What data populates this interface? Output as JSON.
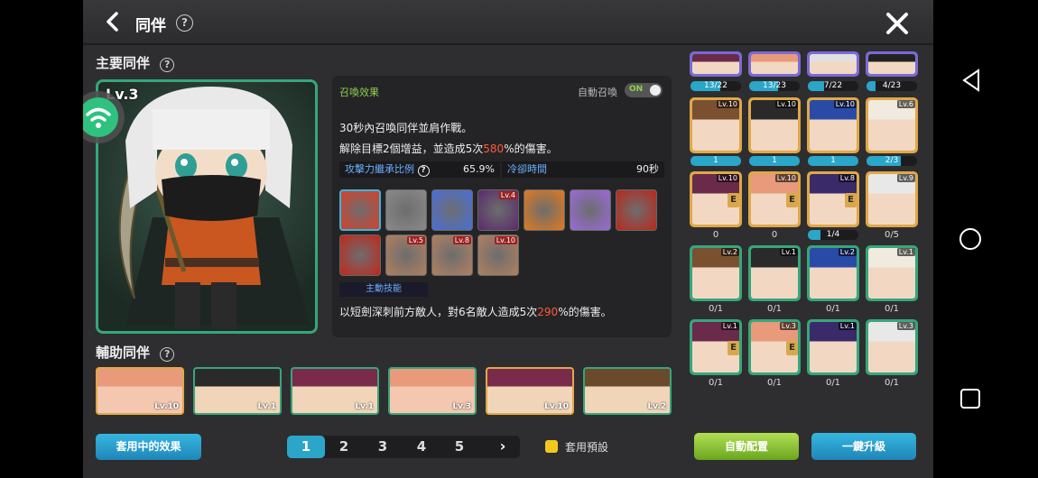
{
  "header": {
    "title": "同伴",
    "help": "?"
  },
  "main_section": {
    "title": "主要同伴",
    "help": "?"
  },
  "main_companion": {
    "level": "Lv.3"
  },
  "summon": {
    "label": "召喚效果",
    "auto_label": "自動召喚",
    "toggle": "ON",
    "line1": "30秒內召喚同伴並肩作戰。",
    "line2_pre": "解除目標2個增益，並造成5次",
    "line2_pct": "580",
    "line2_post": "%的傷害。",
    "stat1_label": "攻擊力繼承比例",
    "stat1_help": "?",
    "stat1_value": "65.9%",
    "stat2_label": "冷卻時間",
    "stat2_value": "90秒",
    "skill_label": "主動技能",
    "skill_desc_pre": "以短劍深刺前方敵人，對6名敵人造成5次",
    "skill_desc_pct": "290",
    "skill_desc_post": "%的傷害。",
    "skills": [
      {
        "lv": ""
      },
      {
        "lv": ""
      },
      {
        "lv": ""
      },
      {
        "lv": "Lv.4"
      },
      {
        "lv": ""
      },
      {
        "lv": ""
      },
      {
        "lv": ""
      },
      {
        "lv": ""
      },
      {
        "lv": "Lv.5"
      },
      {
        "lv": "Lv.8"
      },
      {
        "lv": "Lv.10"
      }
    ]
  },
  "sub_section": {
    "title": "輔助同伴",
    "help": "?"
  },
  "sub_companions": [
    {
      "lv": "Lv.10"
    },
    {
      "lv": "Lv.1"
    },
    {
      "lv": "Lv.1"
    },
    {
      "lv": "Lv.3"
    },
    {
      "lv": "Lv.10"
    },
    {
      "lv": "Lv.2"
    }
  ],
  "grid": {
    "row0": [
      {
        "progress": "13/22",
        "fraction": 0.59
      },
      {
        "progress": "13/23",
        "fraction": 0.57
      },
      {
        "progress": "7/22",
        "fraction": 0.32
      },
      {
        "progress": "4/23",
        "fraction": 0.17
      }
    ],
    "row1": [
      {
        "lv": "Lv.10",
        "progress": "1",
        "fraction": 1
      },
      {
        "lv": "Lv.10",
        "progress": "1",
        "fraction": 1
      },
      {
        "lv": "Lv.10",
        "progress": "1",
        "fraction": 1
      },
      {
        "lv": "Lv.6",
        "progress": "2/3",
        "fraction": 0.67
      }
    ],
    "row2": [
      {
        "lv": "Lv.10",
        "count": "0"
      },
      {
        "lv": "Lv.10",
        "count": "0"
      },
      {
        "lv": "Lv.8",
        "count": "1/4",
        "fraction": 0.25
      },
      {
        "lv": "Lv.9",
        "count": "0/5"
      }
    ],
    "row3": [
      {
        "lv": "Lv.2",
        "count": "0/1"
      },
      {
        "lv": "Lv.1",
        "count": "0/1"
      },
      {
        "lv": "Lv.2",
        "count": "0/1"
      },
      {
        "lv": "Lv.1",
        "count": "0/1"
      }
    ],
    "row4": [
      {
        "lv": "Lv.1",
        "count": "0/1"
      },
      {
        "lv": "Lv.3",
        "count": "0/1"
      },
      {
        "lv": "Lv.1",
        "count": "0/1"
      },
      {
        "lv": "Lv.3",
        "count": "0/1"
      }
    ]
  },
  "footer": {
    "apply_effect": "套用中的效果",
    "pages": [
      "1",
      "2",
      "3",
      "4",
      "5"
    ],
    "next": "›",
    "preset_label": "套用預設",
    "auto_config": "自動配置",
    "one_click_upgrade": "一鍵升級"
  },
  "colors": {
    "accent": "#2aa6c9",
    "green": "#35a77b",
    "gold": "#e0a848",
    "lime": "#8fd14f",
    "red": "#ff5a3c"
  },
  "icons": [
    "back-arrow-icon",
    "close-icon",
    "help-icon",
    "wifi-icon",
    "android-back-icon",
    "android-home-icon",
    "android-recents-icon"
  ]
}
